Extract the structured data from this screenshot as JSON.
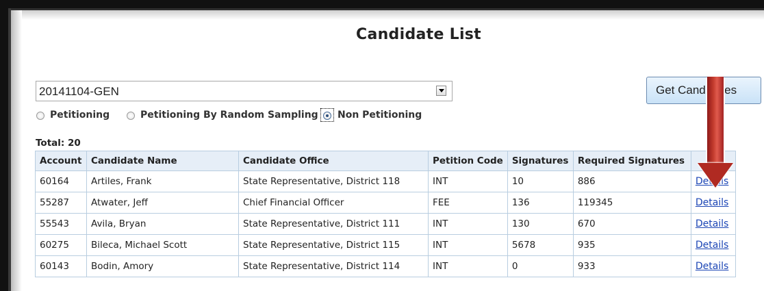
{
  "page": {
    "title": "Candidate List"
  },
  "controls": {
    "election_value": "20141104-GEN",
    "get_button_label": "Get Candidates",
    "radios": [
      {
        "label": "Petitioning",
        "checked": false
      },
      {
        "label": "Petitioning By Random Sampling",
        "checked": false
      },
      {
        "label": "Non Petitioning",
        "checked": true
      }
    ]
  },
  "summary": {
    "total": "Total: 20"
  },
  "table": {
    "columns": [
      "Account",
      "Candidate Name",
      "Candidate Office",
      "Petition Code",
      "Signatures",
      "Required Signatures",
      ""
    ],
    "rows": [
      {
        "account": "60164",
        "name": "Artiles, Frank",
        "office": "State Representative, District 118",
        "code": "INT",
        "signatures": "10",
        "required": "886",
        "link": "Details"
      },
      {
        "account": "55287",
        "name": "Atwater, Jeff",
        "office": "Chief Financial Officer",
        "code": "FEE",
        "signatures": "136",
        "required": "119345",
        "link": "Details"
      },
      {
        "account": "55543",
        "name": "Avila, Bryan",
        "office": "State Representative, District 111",
        "code": "INT",
        "signatures": "130",
        "required": "670",
        "link": "Details"
      },
      {
        "account": "60275",
        "name": "Bileca, Michael Scott",
        "office": "State Representative, District 115",
        "code": "INT",
        "signatures": "5678",
        "required": "935",
        "link": "Details"
      },
      {
        "account": "60143",
        "name": "Bodin, Amory",
        "office": "State Representative, District 114",
        "code": "INT",
        "signatures": "0",
        "required": "933",
        "link": "Details"
      }
    ]
  },
  "annotation": {
    "arrow_color": "#b02a22"
  }
}
